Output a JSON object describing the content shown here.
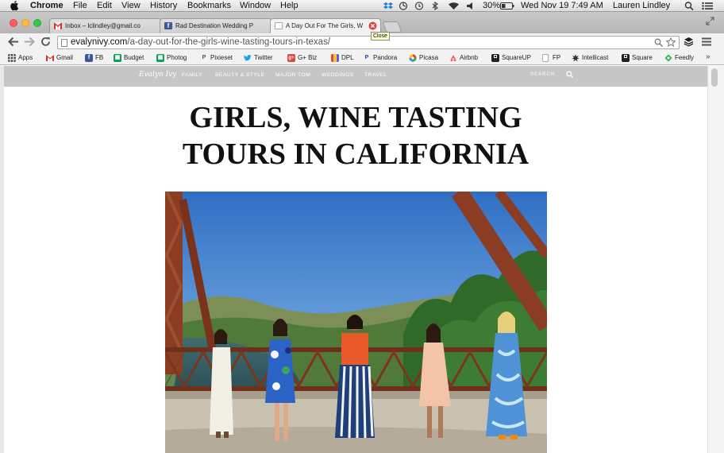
{
  "menubar": {
    "apple": "apple-logo",
    "items": [
      "Chrome",
      "File",
      "Edit",
      "View",
      "History",
      "Bookmarks",
      "Window",
      "Help"
    ],
    "battery": "30%",
    "datetime": "Wed Nov 19  7:49 AM",
    "user": "Lauren Lindley"
  },
  "tabs": [
    {
      "title": "Inbox – lclindley@gmail.co",
      "icon": "gmail-icon",
      "color": "#d93025"
    },
    {
      "title": "Rad Destination Wedding P",
      "icon": "facebook-icon",
      "color": "#3b5998"
    },
    {
      "title": "A Day Out For The Girls, W",
      "icon": "page-icon",
      "color": "#ffffff",
      "active": true
    }
  ],
  "tooltip": "Close",
  "toolbar": {
    "url_host": "evalynivy.com",
    "url_path": "/a-day-out-for-the-girls-wine-tasting-tours-in-texas/"
  },
  "bookmarks": [
    {
      "label": "Apps",
      "icon": "apps-icon",
      "color": "#555555"
    },
    {
      "label": "Gmail",
      "icon": "gmail-icon",
      "color": "#d93025"
    },
    {
      "label": "FB",
      "icon": "facebook-icon",
      "color": "#3b5998"
    },
    {
      "label": "Budget",
      "icon": "sheets-icon",
      "color": "#0f9d58"
    },
    {
      "label": "Photog",
      "icon": "sheets-icon",
      "color": "#0f9d58"
    },
    {
      "label": "Pixieset",
      "icon": "pixieset-icon",
      "color": "#777777"
    },
    {
      "label": "Twitter",
      "icon": "twitter-icon",
      "color": "#1da1f2"
    },
    {
      "label": "G+ Biz",
      "icon": "gplus-icon",
      "color": "#dd4b39"
    },
    {
      "label": "DPL",
      "icon": "dpl-icon",
      "color": "#6a5acd"
    },
    {
      "label": "Pandora",
      "icon": "pandora-icon",
      "color": "#224099"
    },
    {
      "label": "Picasa",
      "icon": "picasa-icon",
      "color": "#e94235"
    },
    {
      "label": "Airbnb",
      "icon": "airbnb-icon",
      "color": "#ff5a5f"
    },
    {
      "label": "SquareUP",
      "icon": "square-icon",
      "color": "#222222"
    },
    {
      "label": "FP",
      "icon": "page-icon",
      "color": "#cccccc"
    },
    {
      "label": "Intellicast",
      "icon": "intellicast-icon",
      "color": "#333333"
    },
    {
      "label": "Square",
      "icon": "square-icon",
      "color": "#222222"
    },
    {
      "label": "Feedly",
      "icon": "feedly-icon",
      "color": "#2bb24c"
    }
  ],
  "site": {
    "logo": "Evalyn Ivy",
    "nav": [
      "FAMILY",
      "BEAUTY & STYLE",
      "MAJOR TOM",
      "WEDDINGS",
      "TRAVEL"
    ],
    "search_label": "SEARCH",
    "title_line1": "GIRLS, WINE TASTING",
    "title_line2": "TOURS IN CALIFORNIA"
  }
}
